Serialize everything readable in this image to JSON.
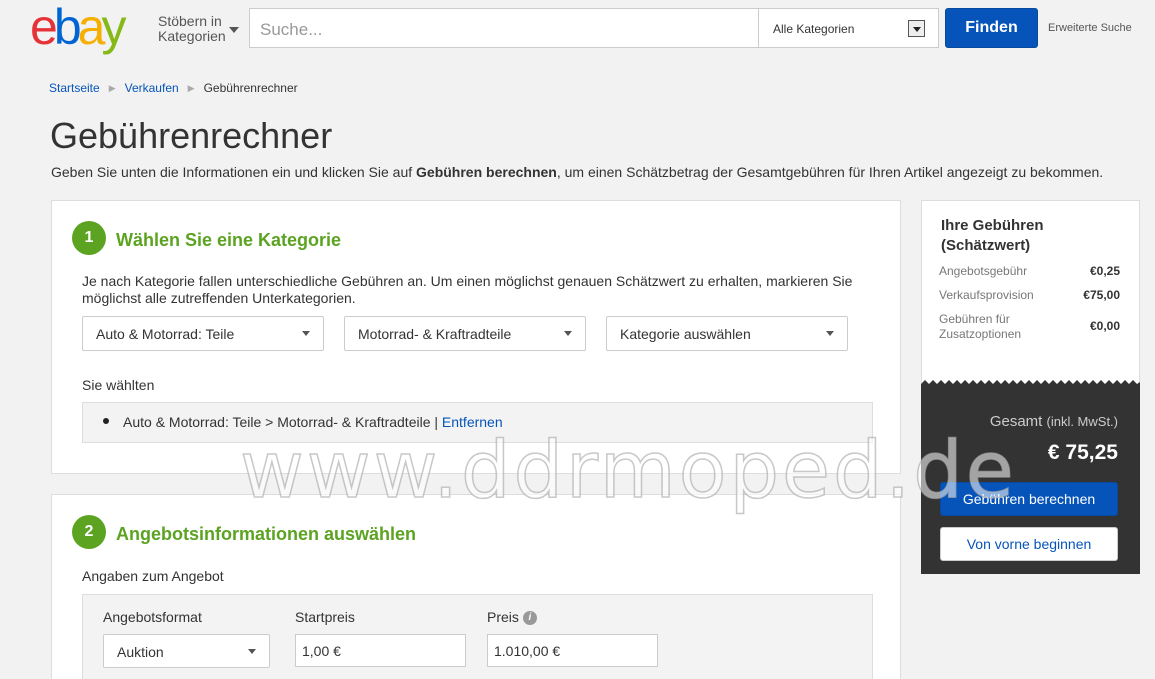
{
  "header": {
    "logo": {
      "e": "e",
      "b": "b",
      "a": "a",
      "y": "y"
    },
    "browse_line1": "Stöbern in",
    "browse_line2": "Kategorien",
    "search_placeholder": "Suche...",
    "category_select": "Alle Kategorien",
    "find_button": "Finden",
    "advanced_search": "Erweiterte Suche"
  },
  "breadcrumb": [
    "Startseite",
    "Verkaufen",
    "Gebührenrechner"
  ],
  "page_title": "Gebührenrechner",
  "intro": {
    "before": "Geben Sie unten die Informationen ein und klicken Sie auf ",
    "bold": "Gebühren berechnen",
    "after": ", um einen Schätzbetrag der Gesamtgebühren für Ihren Artikel angezeigt zu bekommen."
  },
  "step1": {
    "number": "1",
    "title": "Wählen Sie eine Kategorie",
    "description": "Je nach Kategorie fallen unterschiedliche Gebühren an. Um einen möglichst genauen Schätzwert zu erhalten, markieren Sie möglichst alle zutreffenden Unterkategorien.",
    "dropdowns": [
      "Auto & Motorrad: Teile",
      "Motorrad- & Kraftradteile",
      "Kategorie auswählen"
    ],
    "selected_label": "Sie wählten",
    "selected_path": "Auto & Motorrad: Teile > Motorrad- & Kraftradteile | ",
    "remove_link": "Entfernen"
  },
  "step2": {
    "number": "2",
    "title": "Angebotsinformationen auswählen",
    "sub_label": "Angaben zum Angebot",
    "format_label": "Angebotsformat",
    "format_value": "Auktion",
    "start_price_label": "Startpreis",
    "start_price_value": "1,00 €",
    "price_label": "Preis",
    "price_value": "1.010,00 €"
  },
  "fees": {
    "title": "Ihre Gebühren (Schätzwert)",
    "rows": [
      {
        "label": "Angebotsgebühr",
        "value": "€0,25"
      },
      {
        "label": "Verkaufsprovision",
        "value": "€75,00"
      },
      {
        "label": "Gebühren für Zusatzoptionen",
        "value": "€0,00"
      }
    ],
    "total_label": "Gesamt",
    "total_note": "(inkl. MwSt.)",
    "total_amount": "€ 75,25",
    "calc_button": "Gebühren berechnen",
    "reset_button": "Von vorne beginnen"
  },
  "watermark": "www.ddrmoped.de",
  "colors": {
    "accent_blue": "#0654ba",
    "step_green": "#5ba321",
    "dark_total": "#333333"
  }
}
